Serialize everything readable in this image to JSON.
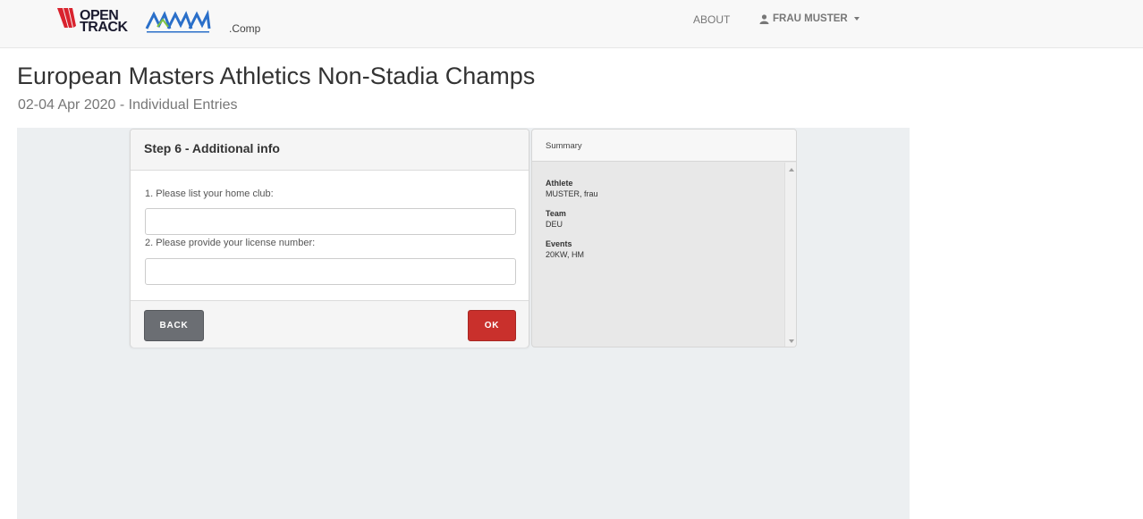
{
  "navbar": {
    "logo_open": "OPEN",
    "logo_track": "TRACK",
    "comp_suffix": ".Comp",
    "about_label": "ABOUT",
    "user_label": "FRAU MUSTER"
  },
  "page": {
    "title": "European Masters Athletics Non-Stadia Champs",
    "subtitle": "02-04 Apr 2020 - Individual Entries"
  },
  "step": {
    "header": "Step 6 - Additional info",
    "q1_label": "1. Please list your home club:",
    "q1_value": "",
    "q2_label": "2. Please provide your license number:",
    "q2_value": "",
    "back_label": "BACK",
    "ok_label": "OK"
  },
  "summary": {
    "header": "Summary",
    "athlete_label": "Athlete",
    "athlete_value": "MUSTER, frau",
    "team_label": "Team",
    "team_value": "DEU",
    "events_label": "Events",
    "events_value": "20KW, HM"
  },
  "colors": {
    "ok_button": "#c9302c",
    "back_button": "#6b6e73",
    "open_track_red": "#d9232e",
    "ema_blue": "#2a6fc9"
  }
}
